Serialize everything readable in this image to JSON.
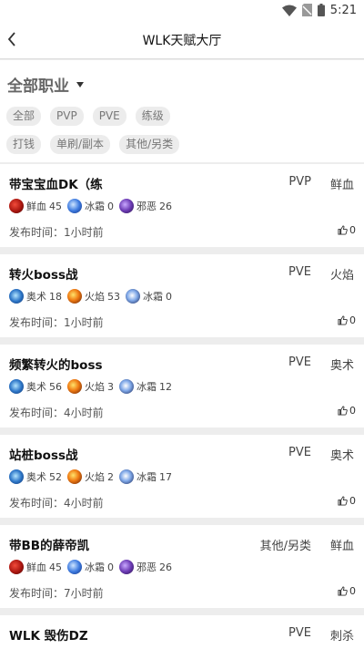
{
  "status_bar": {
    "time": "5:21"
  },
  "header": {
    "title": "WLK天赋大厅"
  },
  "filters": {
    "category_label": "全部职业",
    "row1": [
      "全部",
      "PVP",
      "PVE",
      "练级"
    ],
    "row2": [
      "打钱",
      "单刷/副本",
      "其他/另类"
    ]
  },
  "time_label": "发布时间：",
  "posts": [
    {
      "title": "带宝宝血DK（练",
      "type": "PVP",
      "spec": "鲜血",
      "talents": [
        {
          "name": "鲜血",
          "points": "45",
          "icon": "blood-icon"
        },
        {
          "name": "冰霜",
          "points": "0",
          "icon": "frost-icon"
        },
        {
          "name": "邪恶",
          "points": "26",
          "icon": "unholy-icon"
        }
      ],
      "time": "1小时前",
      "likes": "0"
    },
    {
      "title": "转火boss战",
      "type": "PVE",
      "spec": "火焰",
      "talents": [
        {
          "name": "奥术",
          "points": "18",
          "icon": "arcane-icon"
        },
        {
          "name": "火焰",
          "points": "53",
          "icon": "fire-icon"
        },
        {
          "name": "冰霜",
          "points": "0",
          "icon": "mage-frost-icon"
        }
      ],
      "time": "1小时前",
      "likes": "0"
    },
    {
      "title": "频繁转火的boss",
      "type": "PVE",
      "spec": "奥术",
      "talents": [
        {
          "name": "奥术",
          "points": "56",
          "icon": "arcane-icon"
        },
        {
          "name": "火焰",
          "points": "3",
          "icon": "fire-icon"
        },
        {
          "name": "冰霜",
          "points": "12",
          "icon": "mage-frost-icon"
        }
      ],
      "time": "4小时前",
      "likes": "0"
    },
    {
      "title": "站桩boss战",
      "type": "PVE",
      "spec": "奥术",
      "talents": [
        {
          "name": "奥术",
          "points": "52",
          "icon": "arcane-icon"
        },
        {
          "name": "火焰",
          "points": "2",
          "icon": "fire-icon"
        },
        {
          "name": "冰霜",
          "points": "17",
          "icon": "mage-frost-icon"
        }
      ],
      "time": "4小时前",
      "likes": "0"
    },
    {
      "title": "带BB的薛帝凯",
      "type": "其他/另类",
      "spec": "鲜血",
      "talents": [
        {
          "name": "鲜血",
          "points": "45",
          "icon": "blood-icon"
        },
        {
          "name": "冰霜",
          "points": "0",
          "icon": "frost-icon"
        },
        {
          "name": "邪恶",
          "points": "26",
          "icon": "unholy-icon"
        }
      ],
      "time": "7小时前",
      "likes": "0"
    },
    {
      "title": "WLK 毁伤DZ",
      "type": "PVE",
      "spec": "刺杀"
    }
  ]
}
